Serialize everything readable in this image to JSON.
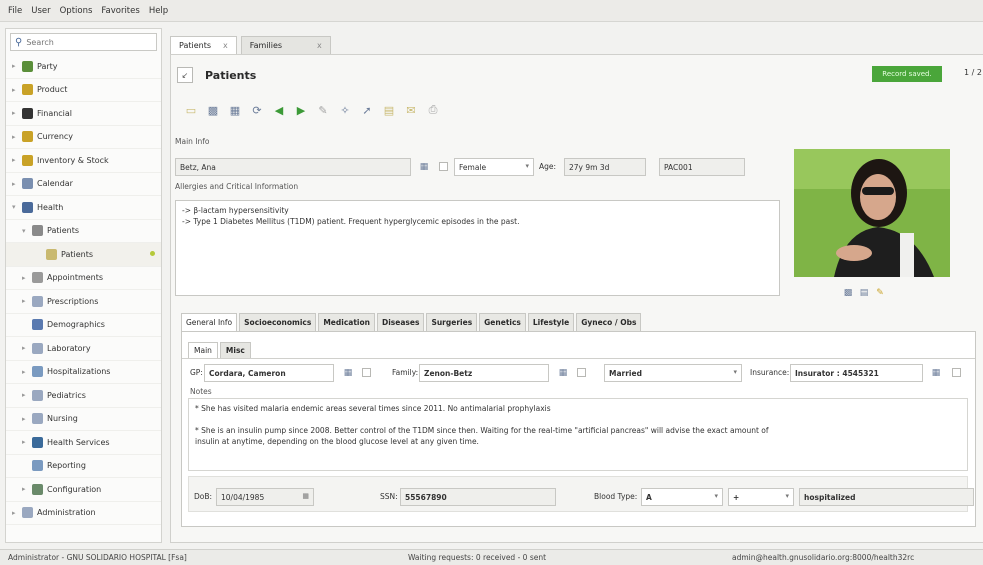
{
  "menubar": [
    "File",
    "User",
    "Options",
    "Favorites",
    "Help"
  ],
  "sidebar": {
    "search_placeholder": "Search",
    "items": [
      {
        "label": "Party",
        "icon": "party-icon",
        "color": "#5b8f3a"
      },
      {
        "label": "Product",
        "icon": "product-icon",
        "color": "#c9a227"
      },
      {
        "label": "Financial",
        "icon": "financial-icon",
        "color": "#333333"
      },
      {
        "label": "Currency",
        "icon": "currency-icon",
        "color": "#c9a227"
      },
      {
        "label": "Inventory & Stock",
        "icon": "inventory-icon",
        "color": "#c9a227"
      },
      {
        "label": "Calendar",
        "icon": "calendar-icon",
        "color": "#7a8fb0"
      },
      {
        "label": "Health",
        "icon": "health-icon",
        "color": "#4a6a9a"
      },
      {
        "label": "Patients",
        "icon": "patients-icon",
        "color": "#8a8a8a"
      },
      {
        "label": "Patients",
        "icon": "patients-list-icon",
        "color": "#c9b96f"
      },
      {
        "label": "Appointments",
        "icon": "appointments-icon",
        "color": "#9a9a9a"
      },
      {
        "label": "Prescriptions",
        "icon": "prescriptions-icon",
        "color": "#9aa8c0"
      },
      {
        "label": "Demographics",
        "icon": "demographics-icon",
        "color": "#5a7ab0"
      },
      {
        "label": "Laboratory",
        "icon": "laboratory-icon",
        "color": "#9aa8c0"
      },
      {
        "label": "Hospitalizations",
        "icon": "hospitalizations-icon",
        "color": "#7a9ac0"
      },
      {
        "label": "Pediatrics",
        "icon": "pediatrics-icon",
        "color": "#9aa8c0"
      },
      {
        "label": "Nursing",
        "icon": "nursing-icon",
        "color": "#9aa8c0"
      },
      {
        "label": "Health Services",
        "icon": "health-services-icon",
        "color": "#3a6a9a"
      },
      {
        "label": "Reporting",
        "icon": "reporting-icon",
        "color": "#7a9ac0"
      },
      {
        "label": "Configuration",
        "icon": "configuration-icon",
        "color": "#6a8a6a"
      },
      {
        "label": "Administration",
        "icon": "administration-icon",
        "color": "#9aa8c0"
      }
    ]
  },
  "tabs": [
    {
      "label": "Patients",
      "close": "x"
    },
    {
      "label": "Families",
      "close": "x"
    }
  ],
  "header": {
    "title": "Patients",
    "collapse": "↙",
    "status": "Record saved.",
    "pager": "1 / 2"
  },
  "main_info_label": "Main Info",
  "patient": {
    "name": "Betz, Ana",
    "gender": "Female",
    "age_label": "Age:",
    "age": "27y 9m 3d",
    "puid": "PAC001"
  },
  "allergies": {
    "label": "Allergies and Critical Information",
    "lines": [
      "-> β-lactam hypersensitivity",
      "-> Type 1 Diabetes Mellitus (T1DM) patient. Frequent hyperglycemic episodes in the past."
    ]
  },
  "subtabs": [
    "General Info",
    "Socioeconomics",
    "Medication",
    "Diseases",
    "Surgeries",
    "Genetics",
    "Lifestyle",
    "Gyneco / Obs"
  ],
  "innertabs": [
    "Main",
    "Misc"
  ],
  "general": {
    "gp_label": "GP:",
    "gp": "Cordara, Cameron",
    "family_label": "Family:",
    "family": "Zenon-Betz",
    "marital": "Married",
    "insurance_label": "Insurance:",
    "insurance": "Insurator : 4545321",
    "notes_label": "Notes",
    "notes": [
      "* She has visited malaria endemic areas several times since 2011. No antimalarial prophylaxis",
      "* She is an insulin pump since 2008. Better control of the T1DM since then. Waiting for the real-time \"artificial pancreas\" will advise the exact amount of",
      "insulin at anytime, depending on the blood glucose level at any given time."
    ],
    "dob_label": "DoB:",
    "dob": "10/04/1985",
    "ssn_label": "SSN:",
    "ssn": "55567890",
    "blood_label": "Blood Type:",
    "blood": "A",
    "rh": "+",
    "status": "hospitalized"
  },
  "statusbar": {
    "left": "Administrator - GNU SOLIDARIO HOSPITAL [Fsa]",
    "mid": "Waiting requests: 0 received - 0 sent",
    "right": "admin@health.gnusolidario.org:8000/health32rc"
  }
}
